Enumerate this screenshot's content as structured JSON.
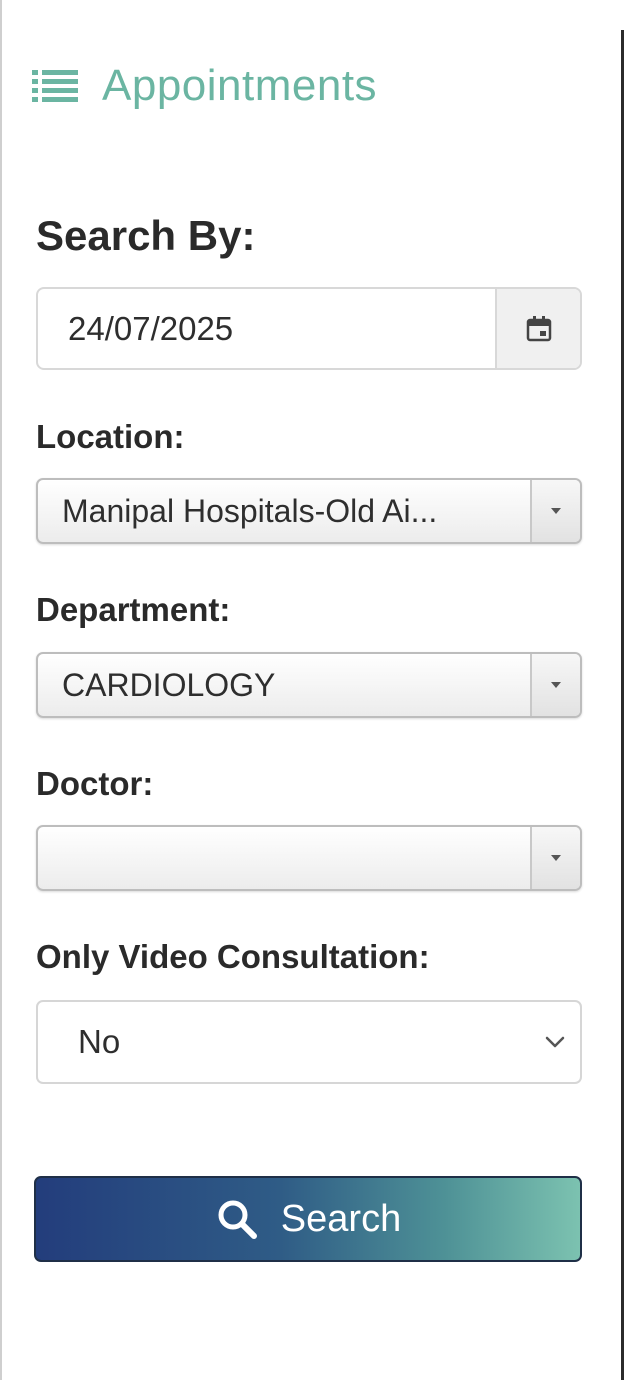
{
  "header": {
    "title": "Appointments",
    "icon": "list-icon",
    "accent_color": "#6bb5a2"
  },
  "search": {
    "heading": "Search By:",
    "date_value": "24/07/2025",
    "calendar_icon": "calendar-icon"
  },
  "fields": {
    "location_label": "Location:",
    "location_value": "Manipal Hospitals-Old Ai...",
    "department_label": "Department:",
    "department_value": "CARDIOLOGY",
    "doctor_label": "Doctor:",
    "doctor_value": "",
    "video_label": "Only Video Consultation:",
    "video_value": "No"
  },
  "button": {
    "label": "Search",
    "icon": "search-icon",
    "gradient_start": "#233d7c",
    "gradient_end": "#7cc2b0"
  }
}
